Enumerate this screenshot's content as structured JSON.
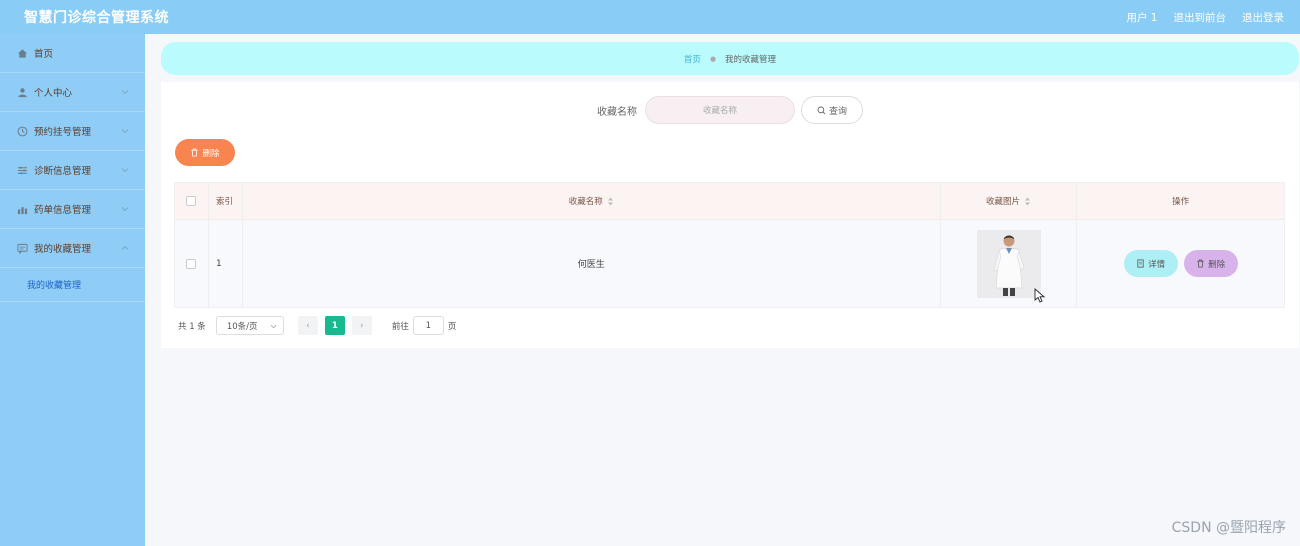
{
  "header": {
    "app_title": "智慧门诊综合管理系统",
    "user_label": "用户 1",
    "back_label": "退出到前台",
    "logout_label": "退出登录"
  },
  "sidebar": {
    "items": [
      {
        "label": "首页",
        "icon": "home-icon"
      },
      {
        "label": "个人中心",
        "icon": "user-icon"
      },
      {
        "label": "预约挂号管理",
        "icon": "clock-icon"
      },
      {
        "label": "诊断信息管理",
        "icon": "sliders-icon"
      },
      {
        "label": "药单信息管理",
        "icon": "chart-icon"
      },
      {
        "label": "我的收藏管理",
        "icon": "chat-icon"
      }
    ],
    "subitem": "我的收藏管理"
  },
  "breadcrumb": {
    "home": "首页",
    "separator": "●",
    "current": "我的收藏管理"
  },
  "search": {
    "label": "收藏名称",
    "placeholder": "收藏名称",
    "button": "查询"
  },
  "actions": {
    "delete_label": "删除"
  },
  "table": {
    "headers": {
      "index": "索引",
      "name": "收藏名称",
      "image": "收藏图片",
      "ops": "操作"
    },
    "rows": [
      {
        "index": "1",
        "name": "何医生",
        "detail": "详情",
        "delete": "删除"
      }
    ]
  },
  "pagination": {
    "total": "共 1 条",
    "page_size": "10条/页",
    "prev": "‹",
    "current": "1",
    "next": "›",
    "goto_label": "前往",
    "goto_value": "1",
    "page_suffix": "页"
  },
  "watermark": "CSDN @暨阳程序",
  "colors": {
    "header": "#89cdf6",
    "sidebar": "#8fcdf6",
    "breadcrumb": "#bafcfd",
    "delete_main": "#f8844f",
    "detail_btn": "#aeeef5",
    "delete_btn": "#d8b2ea",
    "page_active": "#19b990"
  }
}
